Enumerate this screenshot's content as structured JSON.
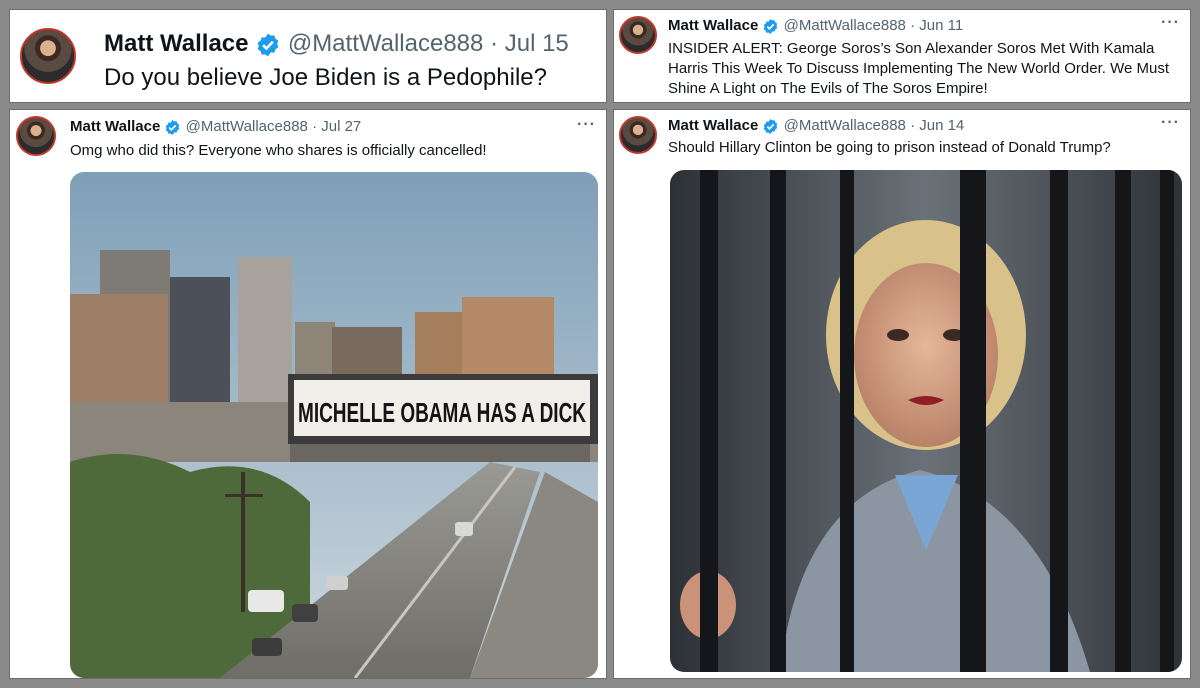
{
  "tweets": [
    {
      "author": "Matt Wallace",
      "handle": "@MattWallace888",
      "date": "Jul 15",
      "text": "Do you believe Joe Biden is a Pedophile?"
    },
    {
      "author": "Matt Wallace",
      "handle": "@MattWallace888",
      "date": "Jun 11",
      "text_lines": [
        "INSIDER ALERT: George Soros’s Son Alexander Soros Met With Kamala",
        "Harris This Week To Discuss Implementing The New World Order. We Must",
        "Shine A Light on The Evils of The Soros Empire!"
      ],
      "more": "···"
    },
    {
      "author": "Matt Wallace",
      "handle": "@MattWallace888",
      "date": "Jul 27",
      "text": "Omg who did this? Everyone who shares is officially cancelled!",
      "more": "···",
      "image": {
        "billboard_text": "MICHELLE OBAMA HAS A DICK"
      }
    },
    {
      "author": "Matt Wallace",
      "handle": "@MattWallace888",
      "date": "Jun 14",
      "text": "Should Hillary Clinton be going to prison instead of Donald Trump?",
      "more": "···"
    }
  ],
  "separator": "·",
  "colors": {
    "verified": "#1d9bf0",
    "meta": "#536471",
    "text": "#0f1419",
    "avatar_border": "#c0392b"
  },
  "icons": [
    "verified-badge-icon",
    "more-options-icon"
  ]
}
